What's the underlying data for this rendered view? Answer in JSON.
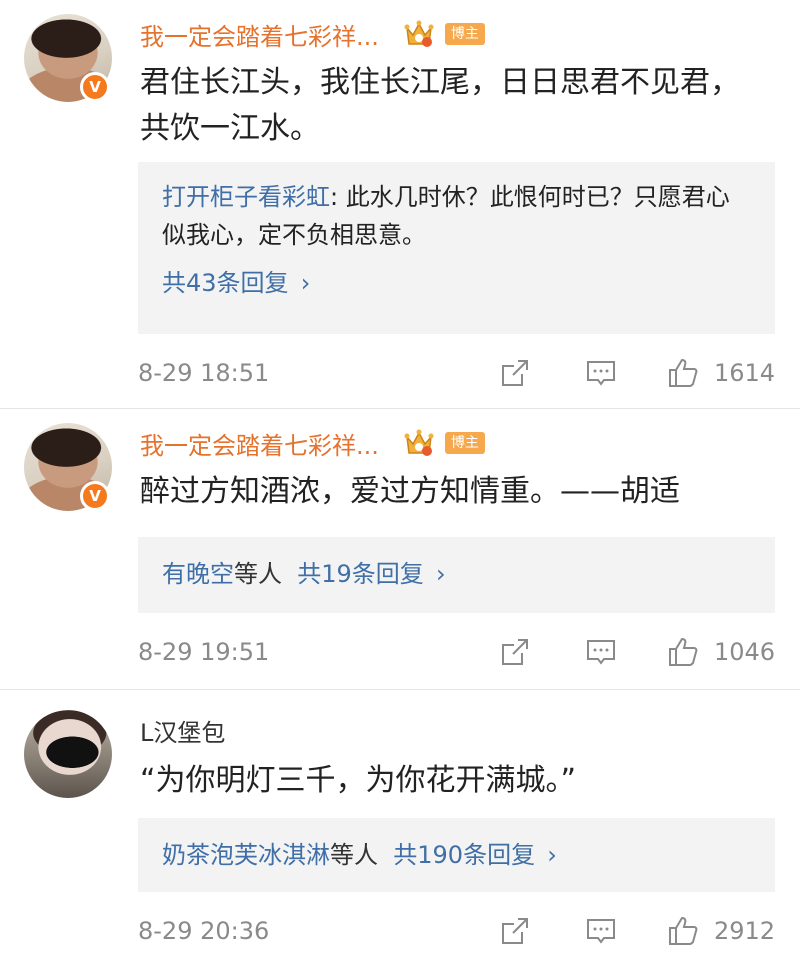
{
  "comments": [
    {
      "username": "我一定会踏着七彩祥...",
      "badge": "博主",
      "text": "君住长江头，我住长江尾，日日思君不见君，共饮一江水。",
      "reply": {
        "author": "打开柜子看彩虹",
        "text": "此水几时休？此恨何时已？只愿君心似我心，定不负相思意。",
        "count_label": "共43条回复"
      },
      "time": "8-29 18:51",
      "likes": "1614"
    },
    {
      "username": "我一定会踏着七彩祥...",
      "badge": "博主",
      "text": "醉过方知酒浓，爱过方知情重。——胡适",
      "reply_summary": {
        "names": "有晚空",
        "suffix": "等人",
        "count_label": "共19条回复"
      },
      "time": "8-29 19:51",
      "likes": "1046"
    },
    {
      "username": "L汉堡包",
      "text": "“为你明灯三千，为你花开满城。”",
      "reply_summary": {
        "names": "奶茶泡芙冰淇淋",
        "suffix": "等人",
        "count_label": "共190条回复"
      },
      "time": "8-29 20:36",
      "likes": "2912"
    }
  ],
  "icons": {
    "verified": "verified-v-badge",
    "crown": "crown-icon",
    "share": "share-icon",
    "comment": "comment-icon",
    "like": "thumbs-up-icon",
    "chevron": "chevron-right-icon"
  },
  "colors": {
    "username": "#e5722d",
    "link": "#3f6fa6",
    "meta": "#8a8a8a",
    "reply_bg": "#f3f3f3",
    "badge": "#f5a84c"
  }
}
